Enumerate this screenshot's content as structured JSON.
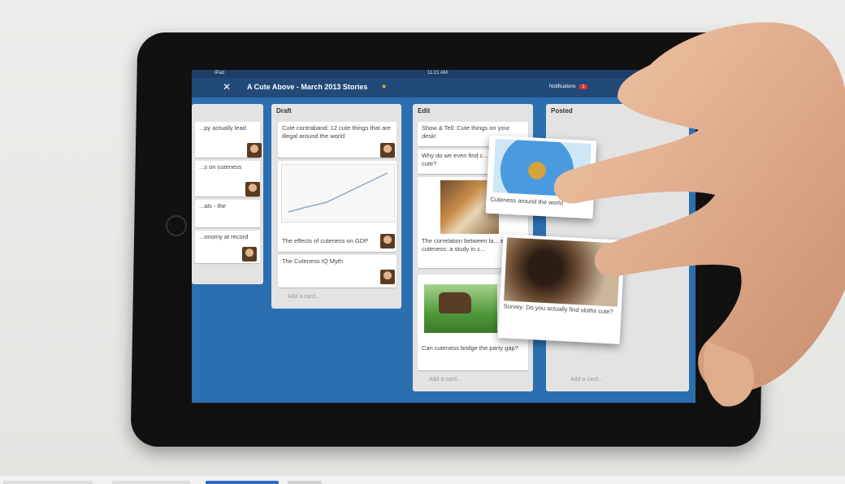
{
  "status": {
    "carrier": "iPad",
    "time": "11:21 AM"
  },
  "board": {
    "close": "✕",
    "title": "A Cute Above - March 2013 Stories",
    "star": "★",
    "notifications": "Notifications",
    "notification_count": "1"
  },
  "lists": {
    "left": {
      "cards": [
        "...py actually lead",
        "...s on cuteness",
        "...als - the",
        "...onomy at record"
      ]
    },
    "draft": {
      "title": "Draft",
      "cards": [
        "Cute contraband: 12 cute things that are illegal around the world",
        "The effects of cuteness on GDP",
        "The Cuteness IQ Myth"
      ],
      "add": "Add a card..."
    },
    "edit": {
      "title": "Edit",
      "cards": [
        "Show & Tell: Cute things on your desk!",
        "Why do we even find c... of food cute?",
        "The correlation between la... and cuteness: a study in c...",
        "Can cuteness bridge the party gap?"
      ],
      "add": "Add a card..."
    },
    "posted": {
      "title": "Posted",
      "add": "Add a card..."
    }
  },
  "dragging": {
    "globe_card": "Cuteness around the world",
    "sloth_card": "Survey: Do you actually find sloths cute?"
  },
  "colors": {
    "screen_bg": "#2c6fb0",
    "topbar": "#224a79",
    "list_bg": "#e3e3e3"
  }
}
